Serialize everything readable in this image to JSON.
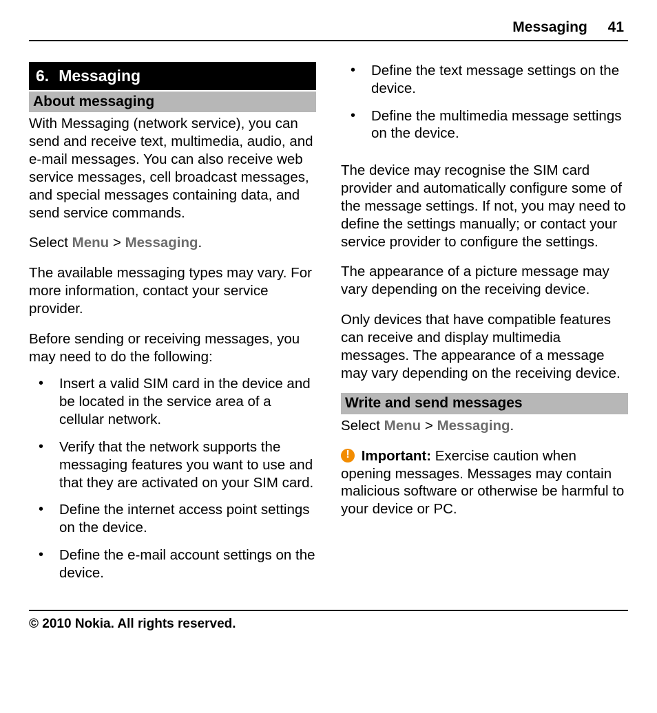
{
  "header": {
    "title": "Messaging",
    "page": "41"
  },
  "chapter": {
    "number": "6.",
    "title": "Messaging"
  },
  "section1": {
    "heading": "About messaging",
    "p1": "With Messaging (network service), you can send and receive text, multimedia, audio, and e-mail messages. You can also receive web service messages, cell broadcast messages, and special messages containing data, and send service commands.",
    "select_prefix": "Select ",
    "select_menu": "Menu",
    "select_gt": " > ",
    "select_messaging": "Messaging",
    "select_suffix": ".",
    "p2": "The available messaging types may vary. For more information, contact your service provider.",
    "p3": "Before sending or receiving messages, you may need to do the following:",
    "bullets": [
      "Insert a valid SIM card in the device and be located in the service area of a cellular network.",
      "Verify that the network supports the messaging features you want to use and that they are activated on your SIM card.",
      "Define the internet access point settings on the device.",
      "Define the e-mail account settings on the device.",
      "Define the text message settings on the device.",
      "Define the multimedia message settings on the device."
    ],
    "p4": "The device may recognise the SIM card provider and automatically configure some of the message settings. If not, you may need to define the settings manually; or contact your service provider to configure the settings.",
    "p5": "The appearance of a picture message may vary depending on the receiving device.",
    "p6": "Only devices that have compatible features can receive and display multimedia messages. The appearance of a message may vary depending on the receiving device."
  },
  "section2": {
    "heading": "Write and send messages",
    "select_prefix": "Select ",
    "select_menu": "Menu",
    "select_gt": " > ",
    "select_messaging": "Messaging",
    "select_suffix": ".",
    "important_label": "Important:",
    "important_text": " Exercise caution when opening messages. Messages may contain malicious software or otherwise be harmful to your device or PC."
  },
  "footer": "© 2010 Nokia. All rights reserved."
}
